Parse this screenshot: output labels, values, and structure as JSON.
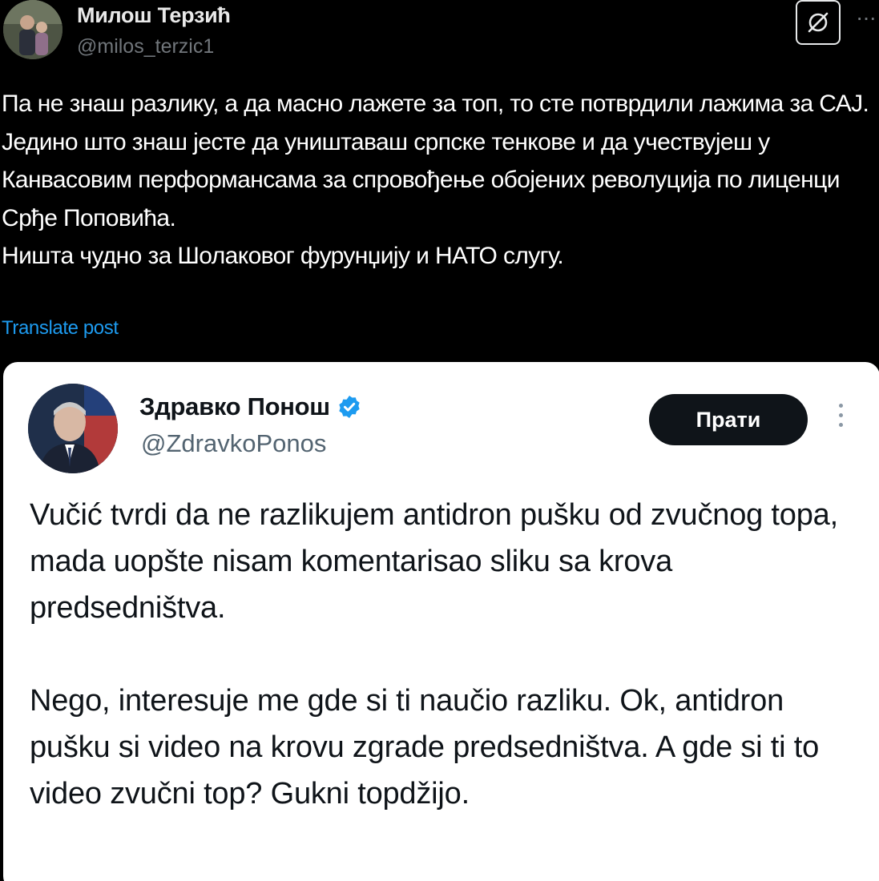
{
  "post": {
    "author_name": "Милош Терзић",
    "author_handle": "@milos_terzic1",
    "more_label": "···",
    "text_lines": [
      "Па не знаш разлику, а да масно лажете за топ, то сте потврдили лажима за САЈ.",
      "Једино што знаш јесте да уништаваш српске тенкове и да учествујеш у Канвасовим перформансама за спровођење обојених револуција по лиценци Срђе Поповића.",
      "Ништа чудно за Шолаковог фурунџију и НАТО слугу."
    ],
    "translate_label": "Translate post"
  },
  "embedded": {
    "author_name": "Здравко Понош",
    "author_handle": "@ZdravkoPonos",
    "follow_label": "Прати",
    "paragraphs": [
      "Vučić tvrdi da ne razlikujem antidron pušku od zvučnog topa, mada uopšte nisam komentarisao sliku sa krova predsedništva.",
      "Nego, interesuje me gde si ti naučio razliku. Ok, antidron pušku si video na krovu zgrade predsedništva. A gde si ti to video zvučni top? Gukni topdžijo."
    ]
  },
  "colors": {
    "background": "#000000",
    "link": "#1d9bf0",
    "verified": "#1d9bf0",
    "muted": "#71767b"
  },
  "icons": [
    "grok-icon",
    "verified-badge-icon",
    "more-icon"
  ]
}
